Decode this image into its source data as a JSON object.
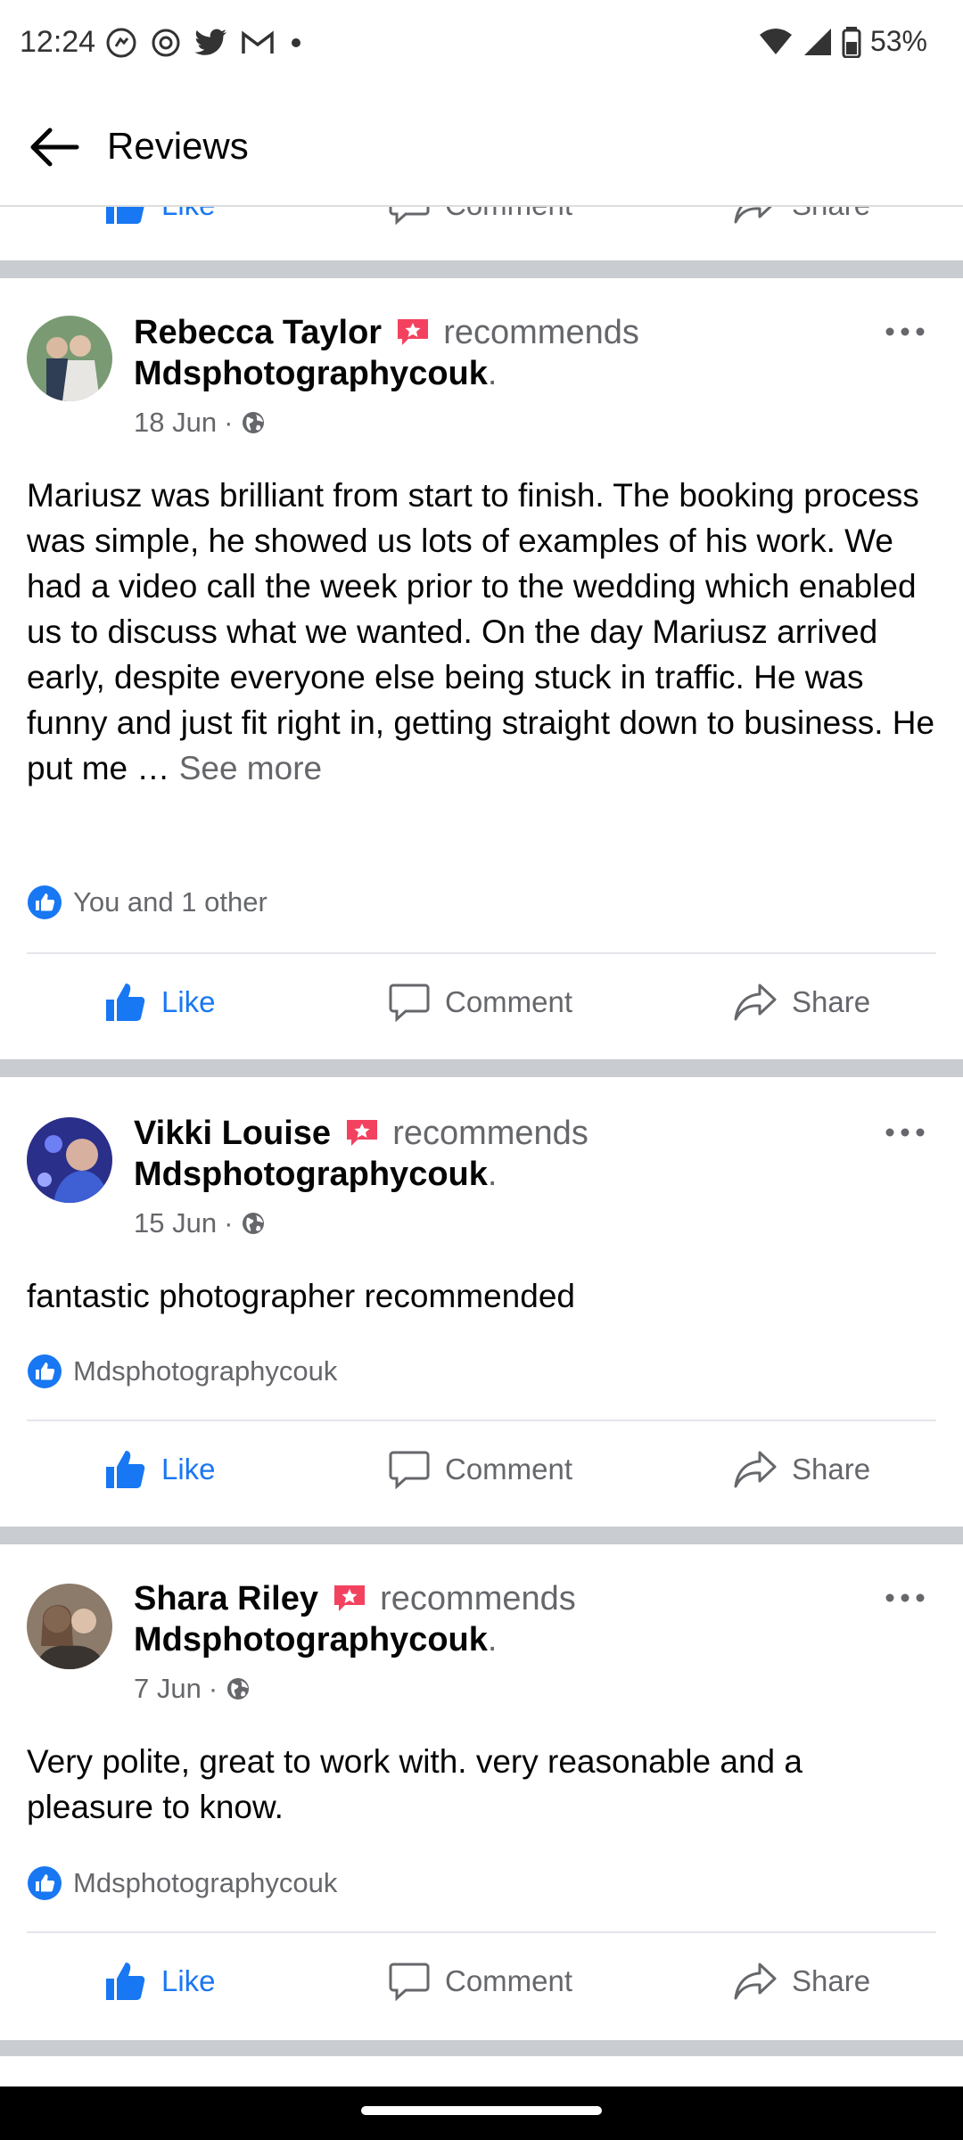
{
  "status_bar": {
    "time": "12:24",
    "battery": "53%"
  },
  "app_bar": {
    "title": "Reviews"
  },
  "actions": {
    "like": "Like",
    "comment": "Comment",
    "share": "Share"
  },
  "posts": [
    {
      "author": "Rebecca Taylor",
      "verb": "recommends",
      "page": "Mdsphotographycouk",
      "date": "18 Jun",
      "text": "Mariusz was brilliant from start to finish. The booking process was simple, he showed us lots of examples of his work. We had a video call the week prior to the wedding which enabled us to discuss what we wanted. On the day Mariusz arrived early, despite everyone else being stuck in traffic. He was funny and just fit right in, getting straight down to business. He put me … ",
      "see_more": "See more",
      "reactions": "You and 1 other"
    },
    {
      "author": "Vikki Louise",
      "verb": "recommends",
      "page": "Mdsphotographycouk",
      "date": "15 Jun",
      "text": "fantastic photographer recommended",
      "reactions": "Mdsphotographycouk"
    },
    {
      "author": "Shara Riley",
      "verb": "recommends",
      "page": "Mdsphotographycouk",
      "date": "7 Jun",
      "text": "Very polite, great to work with. very reasonable and a pleasure to know.",
      "reactions": "Mdsphotographycouk"
    }
  ],
  "colors": {
    "accent": "#1877f2",
    "secondary_text": "#65676b",
    "badge": "#f3425f",
    "divider": "#c9ccd1"
  }
}
